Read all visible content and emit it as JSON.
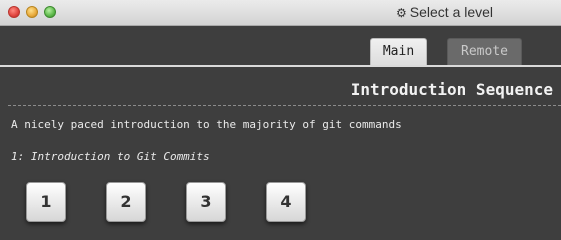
{
  "window": {
    "title": "Select a level",
    "title_icon": "gear-icon"
  },
  "tabs": [
    {
      "label": "Main",
      "selected": true
    },
    {
      "label": "Remote",
      "selected": false
    }
  ],
  "sequence": {
    "title": "Introduction Sequence",
    "about": "A nicely paced introduction to the majority of git commands",
    "selected_level_name": "1: Introduction to Git Commits"
  },
  "levels": [
    {
      "label": "1"
    },
    {
      "label": "2"
    },
    {
      "label": "3"
    },
    {
      "label": "4"
    }
  ],
  "colors": {
    "background": "#3e3e3e",
    "titlebar": "#d8d8d8",
    "tab_selected": "#e6e6e6",
    "tab_unselected": "#6a6a6a",
    "text": "#eaeaea"
  }
}
